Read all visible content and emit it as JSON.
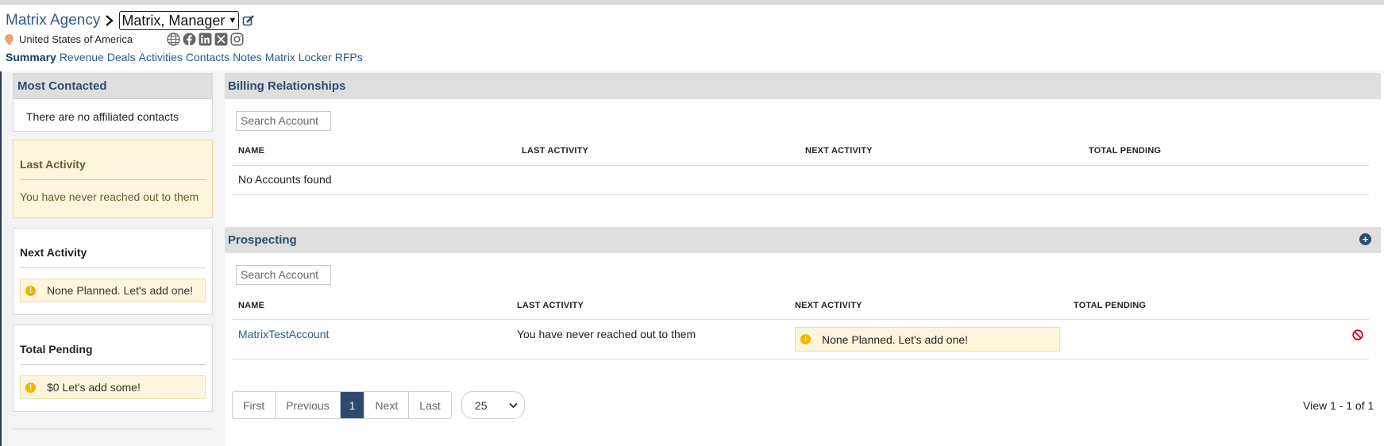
{
  "header": {
    "agency": "Matrix Agency",
    "manager_select": "Matrix, Manager",
    "location": "United States of America",
    "social_icons": [
      "globe-icon",
      "facebook-icon",
      "linkedin-icon",
      "x-icon",
      "instagram-icon"
    ]
  },
  "nav": {
    "tabs": [
      "Summary",
      "Revenue",
      "Deals",
      "Activities",
      "Contacts",
      "Notes",
      "Matrix Locker",
      "RFPs"
    ],
    "active": "Summary"
  },
  "left": {
    "most_contacted": {
      "title": "Most Contacted",
      "empty": "There are no affiliated contacts"
    },
    "last_activity": {
      "title": "Last Activity",
      "message": "You have never reached out to them"
    },
    "next_activity": {
      "title": "Next Activity",
      "notice": "None Planned. Let's add one!"
    },
    "total_pending": {
      "title": "Total Pending",
      "notice": "$0 Let's add some!"
    }
  },
  "billing": {
    "title": "Billing Relationships",
    "search_placeholder": "Search Account",
    "columns": [
      "NAME",
      "LAST ACTIVITY",
      "NEXT ACTIVITY",
      "TOTAL PENDING"
    ],
    "empty": "No Accounts found"
  },
  "prospecting": {
    "title": "Prospecting",
    "search_placeholder": "Search Account",
    "columns": [
      "NAME",
      "LAST ACTIVITY",
      "NEXT ACTIVITY",
      "TOTAL PENDING"
    ],
    "rows": [
      {
        "name": "MatrixTestAccount",
        "last_activity": "You have never reached out to them",
        "next_activity": "None Planned. Let's add one!",
        "total_pending": ""
      }
    ]
  },
  "pagination": {
    "first": "First",
    "previous": "Previous",
    "current": "1",
    "next": "Next",
    "last": "Last",
    "page_size": "25",
    "view_count": "View 1 - 1 of 1"
  },
  "colors": {
    "accent": "#2e4a6e",
    "link": "#2e5a8a",
    "warning": "#f0b400"
  }
}
